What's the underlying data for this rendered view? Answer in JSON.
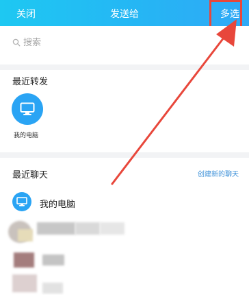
{
  "header": {
    "close_label": "关闭",
    "title": "发送给",
    "multi_select_label": "多选",
    "background_color": "#25b6f4"
  },
  "search": {
    "placeholder": "搜索",
    "icon": "search-icon"
  },
  "recent_forward": {
    "title": "最近转发",
    "items": [
      {
        "label": "我的电脑",
        "icon": "monitor-icon"
      }
    ]
  },
  "recent_chats": {
    "title": "最近聊天",
    "create_label": "创建新的聊天",
    "items": [
      {
        "name": "我的电脑",
        "icon": "monitor-icon"
      }
    ]
  },
  "annotation": {
    "color": "#e8473b"
  }
}
